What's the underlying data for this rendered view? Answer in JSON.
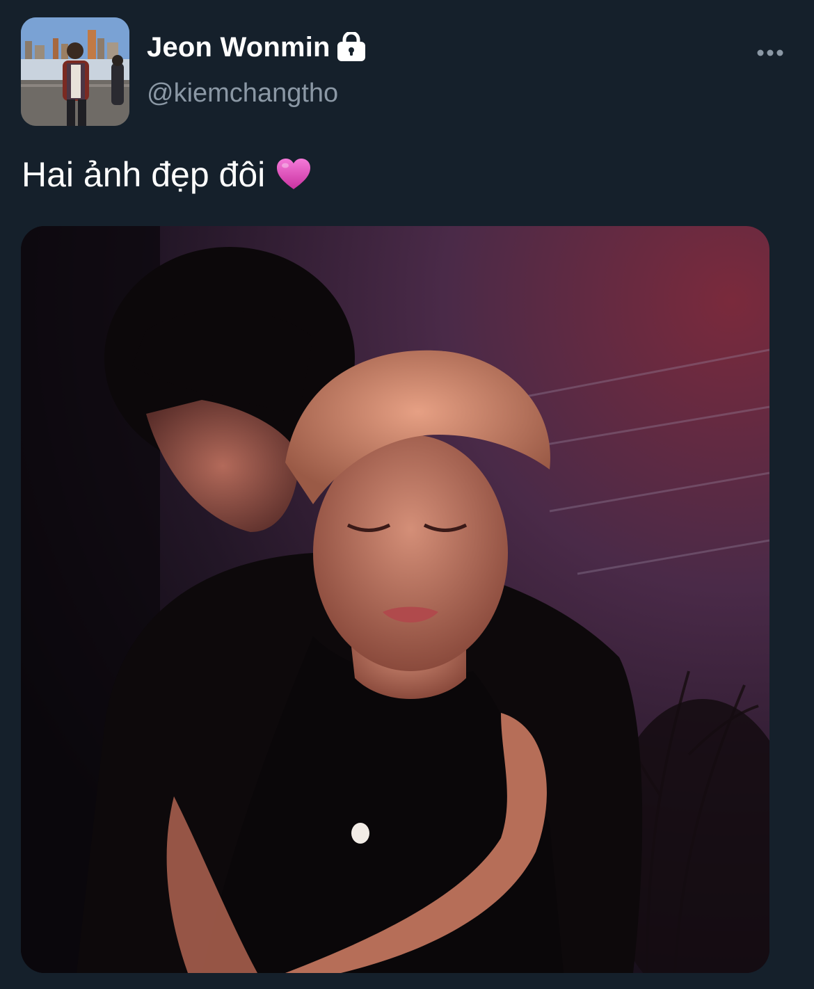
{
  "tweet": {
    "author": {
      "display_name": "Jeon Wonmin",
      "handle": "@kiemchangtho",
      "protected": true,
      "protected_icon": "lock-icon",
      "avatar_icon": "profile-photo"
    },
    "text": "Hai ảnh đẹp đôi",
    "emoji_icon": "pink-heart-icon",
    "more_icon": "more-dots-icon",
    "media": {
      "type": "photo"
    }
  },
  "colors": {
    "background": "#15202b",
    "primary_text": "#ffffff",
    "secondary_text": "#8b98a5",
    "heart": "#e055c8"
  }
}
